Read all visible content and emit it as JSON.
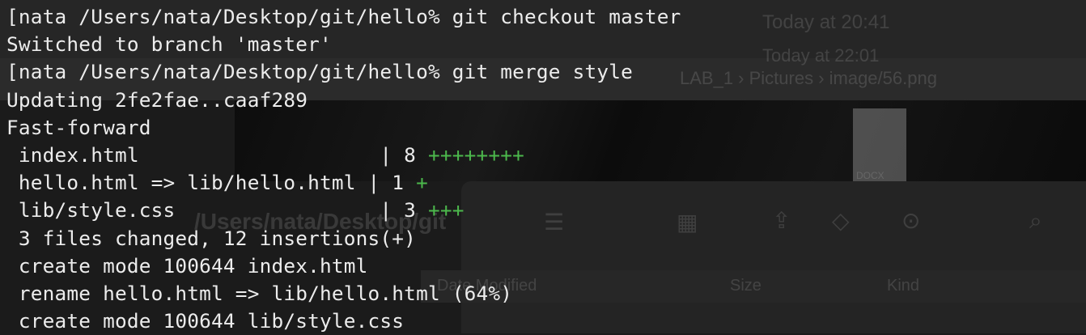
{
  "background": {
    "date_primary": "Today at 20:41",
    "date_secondary": "Today at 22:01",
    "breadcrumb": "LAB_1 › Pictures › image/56.png",
    "doc_thumb_label": "DOCX",
    "finder_path": "/Users/nata/Desktop/git",
    "columns": {
      "date": "Date Modified",
      "size": "Size",
      "kind": "Kind"
    }
  },
  "terminal": {
    "lines": [
      {
        "text": "[nata /Users/nata/Desktop/git/hello% git checkout master"
      },
      {
        "text": "Switched to branch 'master'"
      },
      {
        "text": "[nata /Users/nata/Desktop/git/hello% git merge style"
      },
      {
        "text": "Updating 2fe2fae..caaf289"
      },
      {
        "text": "Fast-forward"
      },
      {
        "text": " index.html                    | 8 ",
        "plus": "++++++++"
      },
      {
        "text": " hello.html => lib/hello.html | 1 ",
        "plus": "+"
      },
      {
        "text": " lib/style.css                 | 3 ",
        "plus": "+++"
      },
      {
        "text": " 3 files changed, 12 insertions(+)"
      },
      {
        "text": " create mode 100644 index.html"
      },
      {
        "text": " rename hello.html => lib/hello.html (64%)"
      },
      {
        "text": " create mode 100644 lib/style.css"
      }
    ]
  },
  "colors": {
    "terminal_bg": "#1b1b1b",
    "text": "#ececec",
    "diffstat_plus": "#4cb84c"
  }
}
